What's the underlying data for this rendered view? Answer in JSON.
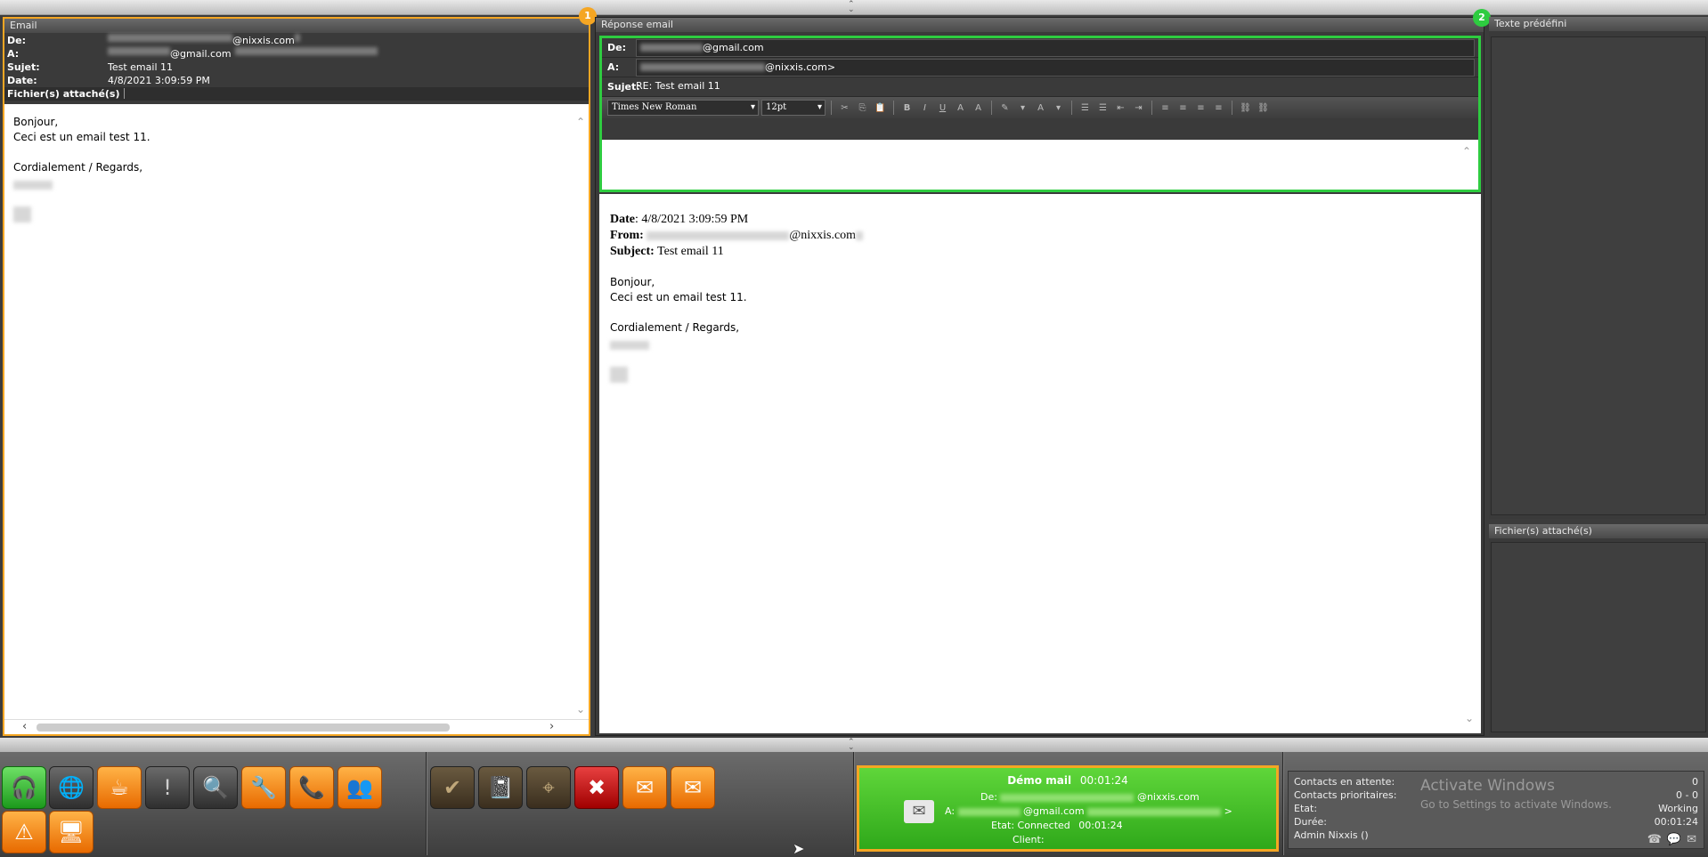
{
  "email": {
    "title": "Email",
    "from_label": "De:",
    "from_value": "@nixxis.com",
    "to_label": "A:",
    "to_value": "@gmail.com",
    "subject_label": "Sujet:",
    "subject_value": "Test email 11",
    "date_label": "Date:",
    "date_value": "4/8/2021 3:09:59 PM",
    "attachments_label": "Fichier(s) attaché(s)",
    "body": [
      "Bonjour,",
      "Ceci est un email test 11.",
      "",
      "Cordialement / Regards,"
    ],
    "badge": "1"
  },
  "reply": {
    "title": "Réponse email",
    "from_label": "De:",
    "from_value": "@gmail.com",
    "to_label": "A:",
    "to_value": "@nixxis.com>",
    "subject_label": "Sujet:",
    "subject_value": "RE: Test email 11",
    "font_name": "Times New Roman",
    "font_size": "12pt",
    "badge": "2",
    "quoted": {
      "date_label": "Date",
      "date_value": ": 4/8/2021 3:09:59 PM",
      "from_label": "From:",
      "from_value": "@nixxis.com",
      "subject_label": "Subject:",
      "subject_value": "Test email 11",
      "body": [
        "Bonjour,",
        "Ceci est un email test 11.",
        "",
        "Cordialement / Regards,"
      ]
    }
  },
  "predefined": {
    "title": "Texte prédéfini"
  },
  "attachments_panel": {
    "title": "Fichier(s) attaché(s)"
  },
  "contact": {
    "title": "Démo mail",
    "timer": "00:01:24",
    "from_label": "De:",
    "from_value": "@nixxis.com",
    "to_label": "A:",
    "to_value": "@gmail.com",
    "to_suffix": ">",
    "state_label": "Etat:",
    "state_value": "Connected",
    "state_timer": "00:01:24",
    "client_label": "Client:"
  },
  "stats": {
    "waiting_label": "Contacts en attente:",
    "waiting_value": "0",
    "priority_label": "Contacts prioritaires:",
    "priority_value": "0 - 0",
    "state_label": "Etat:",
    "state_value": "Working",
    "duration_label": "Durée:",
    "duration_value": "00:01:24",
    "agent": "Admin Nixxis ()",
    "watermark_title": "Activate Windows",
    "watermark_sub": "Go to Settings to activate Windows."
  },
  "colors": {
    "accent_orange": "#f5a623",
    "accent_green": "#2ecc40",
    "card_green": "#4cc22a"
  }
}
